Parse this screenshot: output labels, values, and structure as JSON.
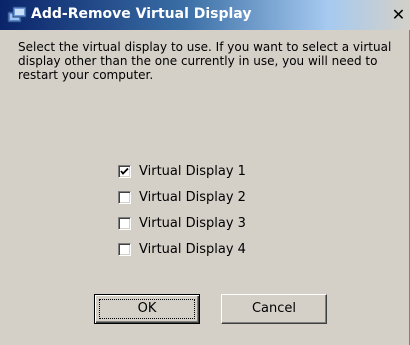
{
  "window": {
    "title": "Add-Remove Virtual Display",
    "icon": "app-display-icon",
    "close_label": "✕",
    "colors": {
      "titlebar_start": "#0a246a",
      "face": "#d4d0c8"
    }
  },
  "description": "Select the virtual display to use. If you want to select a virtual display other than the one currently in use, you will need to restart your computer.",
  "displays": [
    {
      "label": "Virtual Display 1",
      "checked": true
    },
    {
      "label": "Virtual Display 2",
      "checked": false
    },
    {
      "label": "Virtual Display 3",
      "checked": false
    },
    {
      "label": "Virtual Display 4",
      "checked": false
    }
  ],
  "buttons": {
    "ok_label": "OK",
    "cancel_label": "Cancel"
  }
}
